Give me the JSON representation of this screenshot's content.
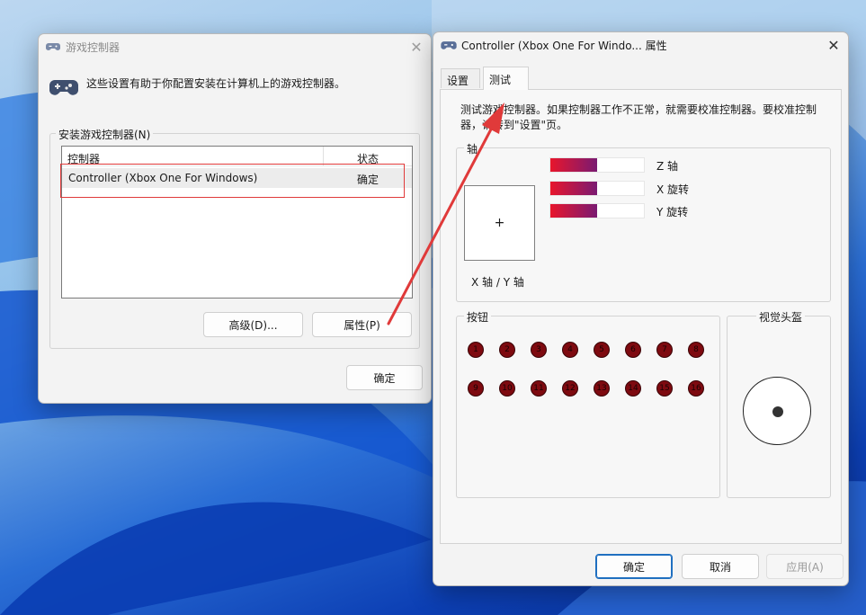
{
  "colors": {
    "accent": "#1f6fc0",
    "highlight": "#e03a3a",
    "button_fill": "#7e0a10"
  },
  "left_dialog": {
    "title": "游戏控制器",
    "description": "这些设置有助于你配置安装在计算机上的游戏控制器。",
    "group_label": "安装游戏控制器(N)",
    "columns": [
      "控制器",
      "状态"
    ],
    "rows": [
      {
        "name": "Controller (Xbox One For Windows)",
        "status": "确定"
      }
    ],
    "advanced_button": "高级(D)...",
    "properties_button": "属性(P)",
    "ok_button": "确定"
  },
  "right_dialog": {
    "title": "Controller (Xbox One For Windo... 属性",
    "tabs": [
      "设置",
      "测试"
    ],
    "active_tab": "测试",
    "description_line1": "测试游戏控制器。如果控制器工作不正常，就需要校准控制器。要校准控制",
    "description_line2": "器，请转到\"设置\"页。",
    "axes_group_label": "轴",
    "axes_bars": [
      {
        "label": "Z 轴",
        "value": 0.5
      },
      {
        "label": "X 旋转",
        "value": 0.5
      },
      {
        "label": "Y 旋转",
        "value": 0.5
      }
    ],
    "xy_label": "X 轴 / Y 轴",
    "xy_cross": "+",
    "buttons_group_label": "按钮",
    "buttons": [
      "1",
      "2",
      "3",
      "4",
      "5",
      "6",
      "7",
      "8",
      "9",
      "10",
      "11",
      "12",
      "13",
      "14",
      "15",
      "16"
    ],
    "pov_group_label": "视觉头盔",
    "ok_button": "确定",
    "cancel_button": "取消",
    "apply_button": "应用(A)"
  }
}
